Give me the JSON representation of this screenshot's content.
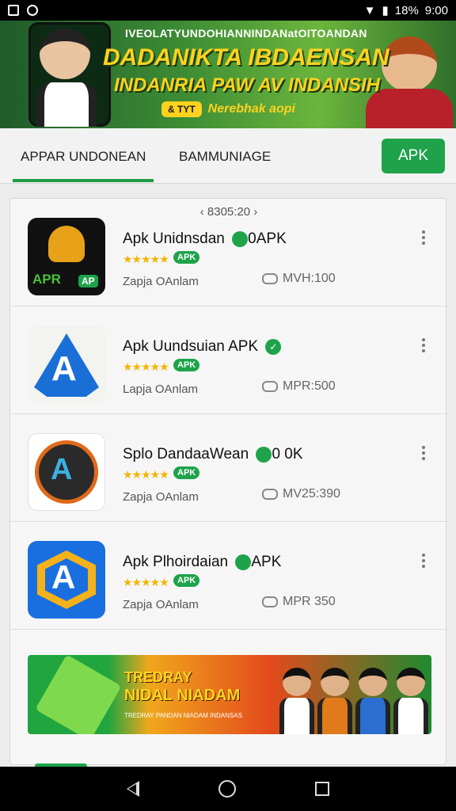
{
  "status_bar": {
    "icons_left": [
      "notification-icon",
      "settings-icon"
    ],
    "battery": "18%",
    "time": "9:00"
  },
  "banner": {
    "top_line": "IVEOLATYUNDOHIANNINDANatOITOANDAN",
    "headline": "DADANIKTA IBDAENSAN",
    "subline": "INDANRIA PAW AV INDANSIH",
    "chip": "& TYT",
    "chip_text": "Nerebhak aopi"
  },
  "tabs": {
    "tab1": "APPAR UNDONEAN",
    "tab2": "BAMMUNIAGE",
    "apk_button": "APK"
  },
  "pager": "‹ 8305:20 ›",
  "apps": [
    {
      "name": "Apk Unidnsdan",
      "suffix": "0APK",
      "stars": "★★★★★",
      "badge": "APK",
      "developer": "Zapja OAnlam",
      "size": "MVH:100",
      "icon_label": "APR",
      "icon_badge": "AP"
    },
    {
      "name": "Apk Uundsuian APK",
      "suffix": "✓",
      "stars": "★★★★★",
      "badge": "APK",
      "developer": "Lapja OAnlam",
      "size": "MPR:500"
    },
    {
      "name": "Splo DandaaWean",
      "suffix": "0 0K",
      "stars": "★★★★★",
      "badge": "APK",
      "developer": "Zapja OAnlam",
      "size": "MV25:390"
    },
    {
      "name": "Apk Plhoirdaian",
      "suffix": "APK",
      "stars": "★★★★★",
      "badge": "APK",
      "developer": "Zapja OAnlam",
      "size": "MPR 350"
    }
  ],
  "promo": {
    "line1": "TREDRAY",
    "line2": "NIDAL NIADAM",
    "line3": "TREDRAY PANDAN NIADAM INDANSAS"
  },
  "colors": {
    "accent_green": "#1ea34b",
    "star": "#f4b400",
    "banner_yellow": "#ffd21e"
  }
}
